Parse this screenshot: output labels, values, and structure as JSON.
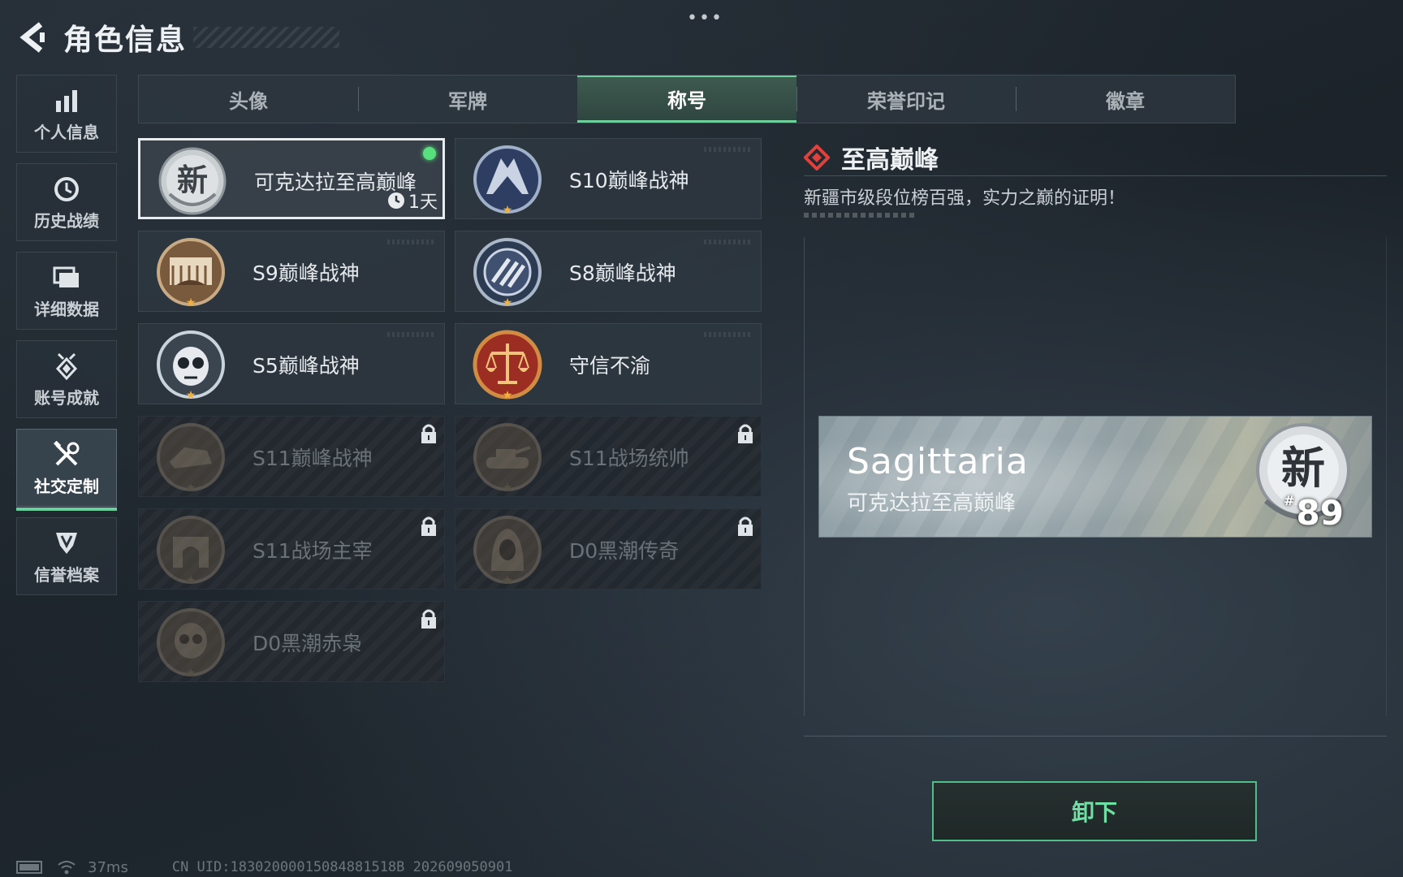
{
  "header": {
    "title": "角色信息"
  },
  "top_dots": "•••",
  "sidebar": {
    "items": [
      {
        "label": "个人信息",
        "icon": "bar-chart-icon"
      },
      {
        "label": "历史战绩",
        "icon": "clock-icon"
      },
      {
        "label": "详细数据",
        "icon": "folder-icon"
      },
      {
        "label": "账号成就",
        "icon": "achievement-icon"
      },
      {
        "label": "社交定制",
        "icon": "tools-icon",
        "active": true
      },
      {
        "label": "信誉档案",
        "icon": "shield-icon"
      }
    ]
  },
  "tabs": [
    {
      "label": "头像"
    },
    {
      "label": "军牌"
    },
    {
      "label": "称号",
      "active": true
    },
    {
      "label": "荣誉印记"
    },
    {
      "label": "徽章"
    }
  ],
  "titles": [
    {
      "name": "可克达拉至高巅峰",
      "selected": true,
      "equipped_dot": true,
      "timer": "1天",
      "medal": "xin-medal-icon"
    },
    {
      "name": "S10巅峰战神",
      "medal": "s10-medal-icon"
    },
    {
      "name": "S9巅峰战神",
      "medal": "s9-medal-icon"
    },
    {
      "name": "S8巅峰战神",
      "medal": "s8-medal-icon"
    },
    {
      "name": "S5巅峰战神",
      "medal": "s5-medal-icon"
    },
    {
      "name": "守信不渝",
      "medal": "scales-medal-icon"
    },
    {
      "name": "S11巅峰战神",
      "locked": true,
      "medal": "s11-medal-icon"
    },
    {
      "name": "S11战场统帅",
      "locked": true,
      "medal": "tank-medal-icon"
    },
    {
      "name": "S11战场主宰",
      "locked": true,
      "medal": "arch-medal-icon"
    },
    {
      "name": "D0黑潮传奇",
      "locked": true,
      "medal": "hooded-medal-icon"
    },
    {
      "name": "D0黑潮赤枭",
      "locked": true,
      "medal": "skull-medal-icon"
    }
  ],
  "detail": {
    "title": "至高巅峰",
    "description": "新疆市级段位榜百强，实力之巅的证明！",
    "preview": {
      "player_name": "Sagittaria",
      "title_text": "可克达拉至高巅峰",
      "rank_prefix": "#",
      "rank": "89"
    },
    "button_label": "卸下"
  },
  "status": {
    "ping": "37ms",
    "uid": "CN UID:18302000015084881518B 202609050901"
  },
  "colors": {
    "accent": "#6fcf9a",
    "diamond": "#e0413c",
    "equipped": "#59e07e"
  }
}
